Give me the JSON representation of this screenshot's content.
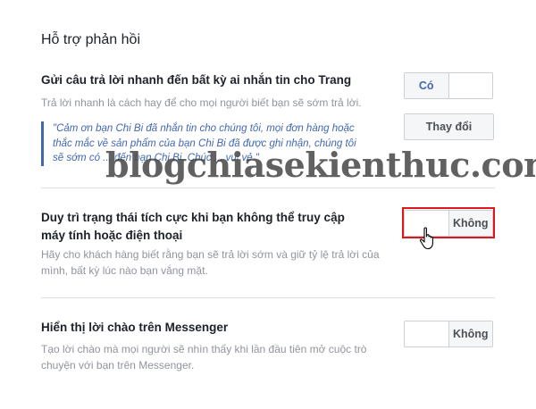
{
  "section_title": "Hỗ trợ phản hồi",
  "instant_reply": {
    "title": "Gửi câu trả lời nhanh đến bất kỳ ai nhắn tin cho Trang",
    "desc": "Trả lời nhanh là cách hay để cho mọi người biết bạn sẽ sớm trả lời.",
    "quote_lines": [
      "\"Cảm ơn bạn Chi Bi đã nhắn tin cho chúng tôi, mọi đơn hàng hoặc",
      "thắc mắc về sản phẩm của bạn Chi Bi đã được ghi nhận, chúng tôi",
      "sẽ sớm có ... đến bạn Chi Bi. Chúc ... vui vẻ.\""
    ],
    "toggle_on_label": "Có",
    "change_button": "Thay đổi"
  },
  "away_status": {
    "title_line1": "Duy trì trạng thái tích cực khi bạn không thể truy cập",
    "title_line2": "máy tính hoặc điện thoại",
    "desc_line1": "Hãy cho khách hàng biết rằng bạn sẽ trả lời sớm và giữ tỷ lệ trả lời của",
    "desc_line2": "mình, bất kỳ lúc nào bạn vắng mặt.",
    "toggle_off_label": "Không"
  },
  "greeting": {
    "title": "Hiển thị lời chào trên Messenger",
    "desc_line1": "Tạo lời chào mà mọi người sẽ nhìn thấy khi lần đầu tiên mở cuộc trò",
    "desc_line2": "chuyện với bạn trên Messenger.",
    "toggle_off_label": "Không"
  },
  "watermark": "blogchiasekienthuc.com",
  "colors": {
    "accent": "#4267b2",
    "highlight": "#e0161d"
  }
}
